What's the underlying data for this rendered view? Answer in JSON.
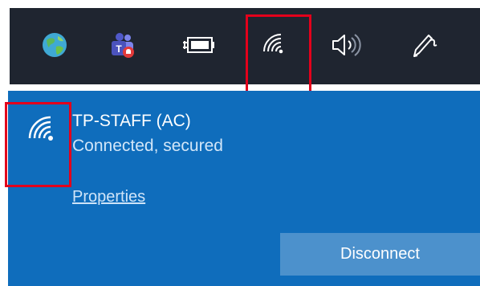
{
  "taskbar": {
    "icons": [
      {
        "icon": "globe-icon"
      },
      {
        "icon": "teams-icon"
      },
      {
        "icon": "battery-charging-icon"
      },
      {
        "icon": "wifi-icon"
      },
      {
        "icon": "volume-icon"
      },
      {
        "icon": "pen-icon"
      }
    ]
  },
  "network": {
    "name": "TP-STAFF (AC)",
    "status": "Connected, secured",
    "properties_label": "Properties",
    "disconnect_label": "Disconnect"
  },
  "colors": {
    "taskbar_bg": "#1f2530",
    "flyout_bg": "#0f6dbc",
    "button_bg": "#4c91cc",
    "highlight": "#e3001b"
  }
}
